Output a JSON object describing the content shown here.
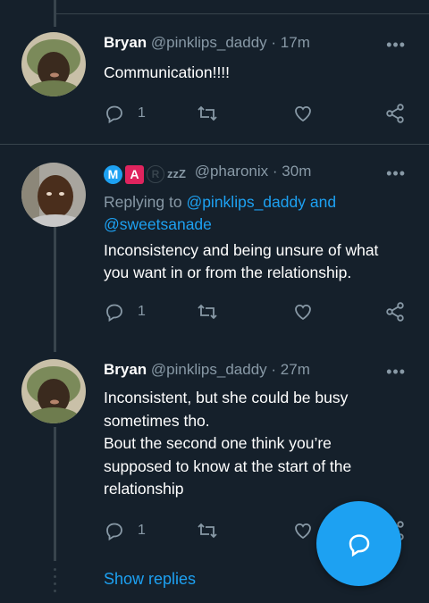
{
  "tweets": [
    {
      "name": "Bryan",
      "handle": "@pinklips_daddy",
      "time": "17m",
      "body": "Communication!!!!",
      "reply_count": "1"
    },
    {
      "name": "",
      "badges": [
        "M",
        "A",
        "R",
        "zzZ"
      ],
      "handle": "@pharonix",
      "time": "30m",
      "replying_prefix": "Replying to",
      "replying_user1": "@pinklips_daddy",
      "replying_and": "and",
      "replying_user2": "@sweetsanade",
      "body_line1": "Inconsistency and being unsure of what",
      "body_line2": "you want in or from the relationship.",
      "reply_count": "1"
    },
    {
      "name": "Bryan",
      "handle": "@pinklips_daddy",
      "time": "27m",
      "body_line1": "Inconsistent, but she could be busy",
      "body_line2": "sometimes tho.",
      "body_line3": "Bout the second one think you’re",
      "body_line4": "supposed to know at the start of the",
      "body_line5": "relationship",
      "reply_count": "1"
    }
  ],
  "show_replies": "Show replies",
  "separator": "·",
  "more_label": "•••",
  "colors": {
    "background": "#15202b",
    "accent": "#1da1f2",
    "muted": "#8899a6",
    "divider": "#38444d"
  },
  "icons": [
    "reply-icon",
    "retweet-icon",
    "like-icon",
    "share-icon",
    "compose-reply-icon"
  ]
}
